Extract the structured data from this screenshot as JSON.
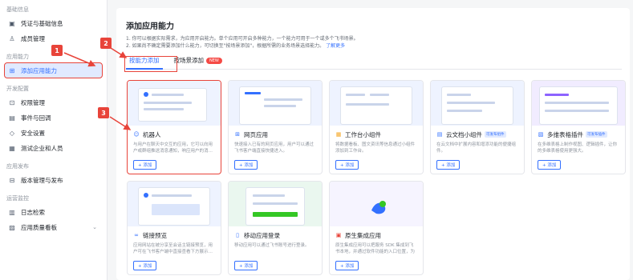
{
  "sidebar": {
    "sections": [
      {
        "label": "基础信息",
        "items": [
          {
            "label": "凭证与基础信息",
            "icon": "credential-icon"
          },
          {
            "label": "成员管理",
            "icon": "user-icon"
          }
        ]
      },
      {
        "label": "应用能力",
        "items": [
          {
            "label": "添加应用能力",
            "icon": "add-capability-icon"
          }
        ]
      },
      {
        "label": "开发配置",
        "items": [
          {
            "label": "权限管理",
            "icon": "lock-icon"
          },
          {
            "label": "事件与回调",
            "icon": "event-icon"
          },
          {
            "label": "安全设置",
            "icon": "shield-icon"
          },
          {
            "label": "测试企业和人员",
            "icon": "test-icon"
          }
        ]
      },
      {
        "label": "应用发布",
        "items": [
          {
            "label": "版本管理与发布",
            "icon": "version-icon"
          }
        ]
      },
      {
        "label": "运营监控",
        "items": [
          {
            "label": "日志检索",
            "icon": "log-icon"
          },
          {
            "label": "应用质量看板",
            "icon": "chart-icon"
          }
        ]
      }
    ]
  },
  "main": {
    "title": "添加应用能力",
    "desc_line1": "1. 你可以根据实际需求，为应用开启能力。单个应用可开启多种能力，一个能力可用于一个或多个飞书场景。",
    "desc_line2": "2. 如果尚不确定需要添加什么能力，可切换至\"按场景添加\"，根据所需的业务场景选择能力。",
    "desc_link": "了解更多",
    "tabs": [
      {
        "label": "按能力添加"
      },
      {
        "label": "按场景添加"
      }
    ],
    "tab_badge": "NEW",
    "add_label": "+ 添加"
  },
  "cards": [
    {
      "title": "机器人",
      "icon": "robot-icon",
      "desc": "与用户在聊天中交互的应用，它可以向用户或群组推送消息通知，响应用户的消…",
      "badge": ""
    },
    {
      "title": "网页应用",
      "icon": "web-icon",
      "desc": "快速接入已有的网页应用，用户可以通过飞书客户端直接快捷进入。",
      "badge": ""
    },
    {
      "title": "工作台小组件",
      "icon": "widget-icon",
      "desc": "将数据看板、图文资讯等信息通过小组件添加到工作台。",
      "badge": ""
    },
    {
      "title": "云文档小组件",
      "icon": "doc-widget-icon",
      "desc": "在云文档中扩展内容和增添功能的便捷组件。",
      "badge": "可发布组件"
    },
    {
      "title": "多维表格插件",
      "icon": "table-plugin-icon",
      "desc": "在多维表格上制作视图、逻辑插件，让你的多维表格使用更强大。",
      "badge": "可发布插件"
    },
    {
      "title": "链接预览",
      "icon": "link-icon",
      "desc": "应用网站在被分享至会话主链接预览，用户可在飞书客户端中直接查看下方展示…",
      "badge": ""
    },
    {
      "title": "移动应用登录",
      "icon": "mobile-login-icon",
      "desc": "移动应用可以通过飞书账号进行登录。",
      "badge": ""
    },
    {
      "title": "原生集成应用",
      "icon": "native-app-icon",
      "desc": "原生集成应用可以把服务 SDK 集成到飞书本地，并通过软件功能的入口位置，为用户提…",
      "badge": ""
    }
  ],
  "annotations": [
    "1",
    "2",
    "3"
  ],
  "colors": {
    "accent": "#3370ff",
    "annotation": "#e8443a",
    "badge_red": "#f54a45"
  }
}
